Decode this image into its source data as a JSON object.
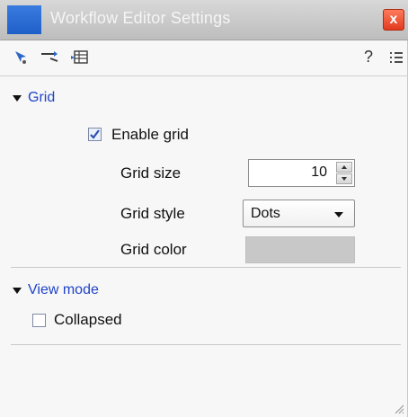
{
  "window": {
    "title": "Workflow Editor Settings",
    "close_label": "x"
  },
  "toolbar": {
    "icons": [
      "pointer-tool-icon",
      "connect-tool-icon",
      "table-view-icon",
      "help-icon",
      "list-icon"
    ],
    "help_label": "?"
  },
  "sections": {
    "grid": {
      "title": "Grid",
      "enable_grid_label": "Enable grid",
      "enable_grid_checked": true,
      "grid_size_label": "Grid size",
      "grid_size_value": "10",
      "grid_style_label": "Grid style",
      "grid_style_value": "Dots",
      "grid_color_label": "Grid color",
      "grid_color_value": "#c8c8c8"
    },
    "view_mode": {
      "title": "View mode",
      "collapsed_label": "Collapsed",
      "collapsed_checked": false
    }
  },
  "colors": {
    "section_header": "#1f44c8",
    "title_accent": "#2a6ad6",
    "close_button": "#e23b1e"
  }
}
